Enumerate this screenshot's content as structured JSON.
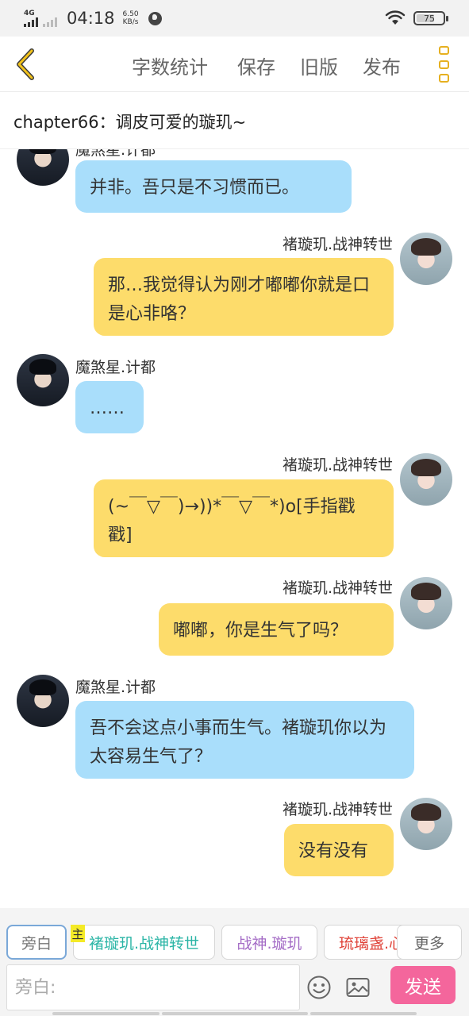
{
  "status": {
    "network": "4G",
    "time": "04:18",
    "speed_value": "6.50",
    "speed_unit": "KB/s",
    "battery": "75"
  },
  "toolbar": {
    "word_count": "字数统计",
    "save": "保存",
    "old_version": "旧版",
    "publish": "发布"
  },
  "chapter": {
    "title": "chapter66：调皮可爱的璇玑~"
  },
  "messages": [
    {
      "speaker": "魔煞星.计都",
      "side": "left",
      "text": "并非。吾只是不习惯而已。"
    },
    {
      "speaker": "褚璇玑.战神转世",
      "side": "right",
      "text": "那…我觉得认为刚才嘟嘟你就是口是心非咯？"
    },
    {
      "speaker": "魔煞星.计都",
      "side": "left",
      "text": "……"
    },
    {
      "speaker": "褚璇玑.战神转世",
      "side": "right",
      "text": "(~￣▽￣)→))*￣▽￣*)o[手指戳戳]"
    },
    {
      "speaker": "褚璇玑.战神转世",
      "side": "right",
      "text": "嘟嘟，你是生气了吗？"
    },
    {
      "speaker": "魔煞星.计都",
      "side": "left",
      "text": "吾不会这点小事而生气。褚璇玑你以为太容易生气了？"
    },
    {
      "speaker": "褚璇玑.战神转世",
      "side": "right",
      "text": "没有没有"
    }
  ],
  "roles": [
    {
      "label": "旁白",
      "color": "#777777"
    },
    {
      "label": "褚璇玑.战神转世",
      "color": "#2bb5a6",
      "badge": "主"
    },
    {
      "label": "战神.璇玑",
      "color": "#a46cc6"
    },
    {
      "label": "琉璃盏.心",
      "color": "#e0443a"
    },
    {
      "label": "更多",
      "color": "#666666"
    }
  ],
  "composer": {
    "placeholder": "旁白:",
    "send": "发送"
  }
}
